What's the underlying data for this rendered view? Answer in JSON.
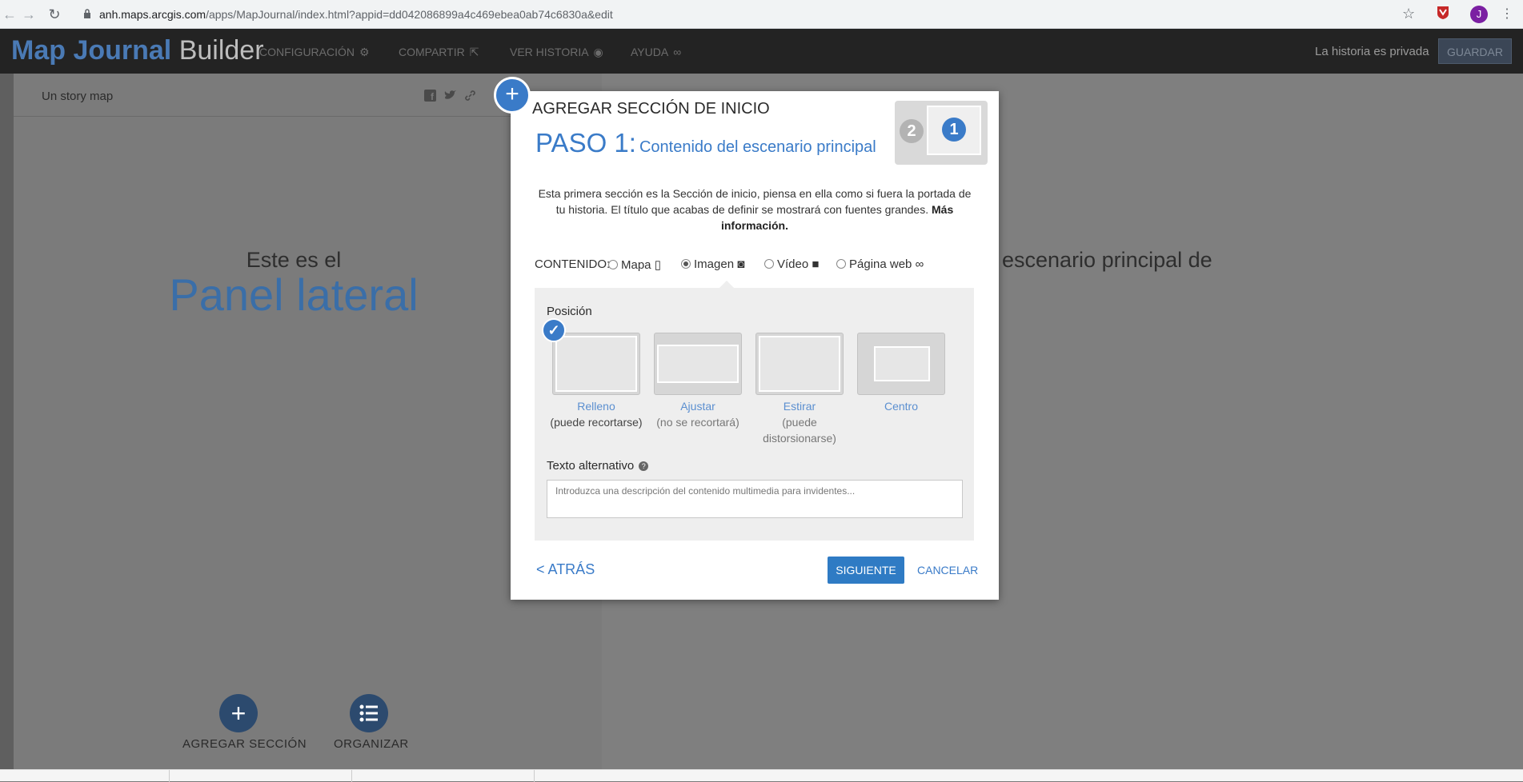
{
  "browser": {
    "url_host": "anh.maps.arcgis.com",
    "url_path": "/apps/MapJournal/index.html?appid=dd042086899a4c469ebea0ab74c6830a&edit",
    "profile_initial": "J"
  },
  "header": {
    "brand_main": "Map Journal",
    "brand_sub": "Builder",
    "nav": [
      {
        "label": "CONFIGURACIÓN"
      },
      {
        "label": "COMPARTIR"
      },
      {
        "label": "VER HISTORIA"
      },
      {
        "label": "AYUDA"
      }
    ],
    "privacy_status": "La historia es privada",
    "save_label": "GUARDAR"
  },
  "side_panel": {
    "story_title": "Un story map",
    "subtitle": "Este es el",
    "title": "Panel lateral",
    "add_section_label": "AGREGAR SECCIÓN",
    "organize_label": "ORGANIZAR"
  },
  "main_stage": {
    "text": "escenario principal de"
  },
  "modal": {
    "title": "AGREGAR SECCIÓN DE INICIO",
    "step_label": "PASO 1:",
    "step_subtitle": "Contenido del escenario principal",
    "step_current": "1",
    "step_next": "2",
    "description": "Esta primera sección es la Sección de inicio, piensa en ella como si fuera la portada de tu historia. El título que acabas de definir se mostrará con fuentes grandes.",
    "more_info": "Más información.",
    "content_label": "CONTENIDO:",
    "content_options": [
      {
        "label": "Mapa",
        "selected": false
      },
      {
        "label": "Imagen",
        "selected": true
      },
      {
        "label": "Vídeo",
        "selected": false
      },
      {
        "label": "Página web",
        "selected": false
      }
    ],
    "position_label": "Posición",
    "positions": [
      {
        "name": "Relleno",
        "note": "(puede recortarse)",
        "selected": true
      },
      {
        "name": "Ajustar",
        "note": "(no se recortará)",
        "selected": false
      },
      {
        "name": "Estirar",
        "note": "(puede distorsionarse)",
        "selected": false
      },
      {
        "name": "Centro",
        "note": "",
        "selected": false
      }
    ],
    "alt_text_label": "Texto alternativo",
    "alt_text_placeholder": "Introduzca una descripción del contenido multimedia para invidentes...",
    "back_label": "< ATRÁS",
    "next_label": "SIGUIENTE",
    "cancel_label": "CANCELAR"
  },
  "colors": {
    "accent": "#3a7bc8",
    "header_bg": "#232323",
    "overlay_gray": "#7b7b7b"
  }
}
